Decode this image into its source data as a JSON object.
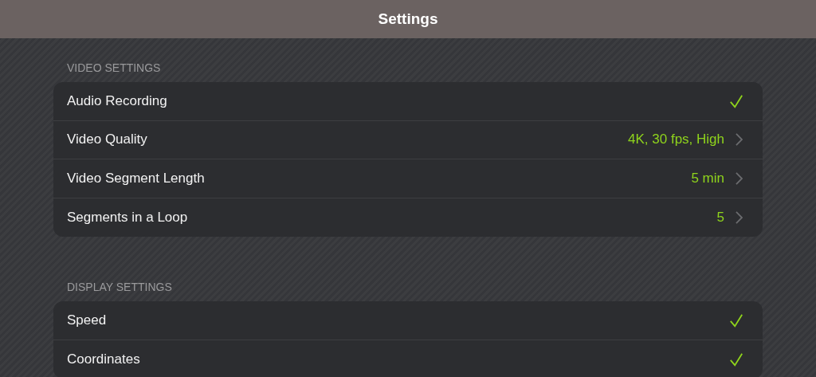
{
  "title": "Settings",
  "sections": [
    {
      "header": "VIDEO SETTINGS",
      "rows": [
        {
          "kind": "toggle",
          "label": "Audio Recording",
          "checked": true
        },
        {
          "kind": "value",
          "label": "Video Quality",
          "value": "4K, 30 fps, High"
        },
        {
          "kind": "value",
          "label": "Video Segment Length",
          "value": "5 min"
        },
        {
          "kind": "value",
          "label": "Segments in a Loop",
          "value": "5"
        }
      ]
    },
    {
      "header": "DISPLAY SETTINGS",
      "rows": [
        {
          "kind": "toggle",
          "label": "Speed",
          "checked": true
        },
        {
          "kind": "toggle",
          "label": "Coordinates",
          "checked": true
        }
      ]
    }
  ]
}
